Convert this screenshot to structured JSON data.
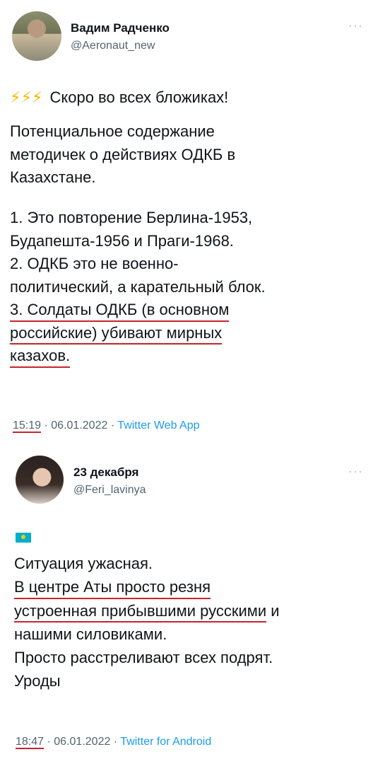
{
  "tweets": [
    {
      "author_name": "Вадим Радченко",
      "handle": "@Aeronaut_new",
      "more": "···",
      "emoji": "⚡⚡⚡",
      "intro": "Скоро во всех бложиках!",
      "paragraph_lines": [
        "Потенциальное содержание",
        "методичек о действиях ОДКБ в",
        "Казахстане."
      ],
      "list_lines": [
        "1. Это повторение Берлина-1953,",
        "Будапешта-1956 и Праги-1968.",
        "2. ОДКБ это не военно-",
        "политический, а карательный блок."
      ],
      "underlined_lines": [
        "3. Солдаты ОДКБ (в основном",
        "российские) убивают мирных",
        "казахов."
      ],
      "time": "15:19",
      "separator": "·",
      "date": "06.01.2022",
      "app": "Twitter Web App"
    },
    {
      "author_name": "23 декабря",
      "handle": "@Feri_lavinya",
      "more": "···",
      "lines": [
        "Ситуация ужасная."
      ],
      "underlined_lines": [
        "В центре Аты просто резня",
        "устроенная прибывшими русскими"
      ],
      "line_suffix": " и",
      "rest_lines": [
        "нашими силовиками.",
        "Просто расстреливают всех подрят.",
        "Уроды"
      ],
      "time": "18:47",
      "separator": "·",
      "date": "06.01.2022",
      "app": "Twitter for Android"
    }
  ]
}
